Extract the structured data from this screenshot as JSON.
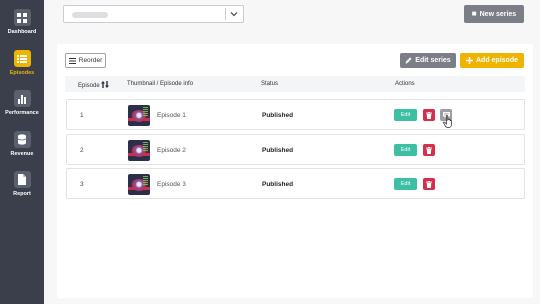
{
  "sidebar": {
    "items": [
      {
        "label": "Dashboard",
        "icon": "grid-icon",
        "active": false
      },
      {
        "label": "Episodes",
        "icon": "list-icon",
        "active": true
      },
      {
        "label": "Performance",
        "icon": "bar-chart-icon",
        "active": false
      },
      {
        "label": "Revenue",
        "icon": "database-icon",
        "active": false
      },
      {
        "label": "Report",
        "icon": "document-icon",
        "active": false
      }
    ]
  },
  "header": {
    "series_select": {
      "value": "",
      "icon": "chevron-down-icon"
    },
    "new_series_label": "New series"
  },
  "toolbar": {
    "reorder_label": "Reorder",
    "edit_series_label": "Edit series",
    "add_episode_label": "Add episode"
  },
  "table": {
    "headers": {
      "episode": "Episode",
      "thumbnail": "Thumbnail / Episode info",
      "status": "Status",
      "actions": "Actions"
    },
    "rows": [
      {
        "number": "1",
        "title": "Episode 1",
        "status": "Published",
        "edit": "Edit",
        "has_message": true
      },
      {
        "number": "2",
        "title": "Episode 2",
        "status": "Published",
        "edit": "Edit",
        "has_message": false
      },
      {
        "number": "3",
        "title": "Episode 3",
        "status": "Published",
        "edit": "Edit",
        "has_message": false
      }
    ]
  },
  "colors": {
    "sidebar_bg": "#3a3f4b",
    "accent": "#f0b400",
    "edit_button": "#3cbfa2",
    "delete_button": "#d2304d",
    "neutral_button": "#7b7e87"
  }
}
